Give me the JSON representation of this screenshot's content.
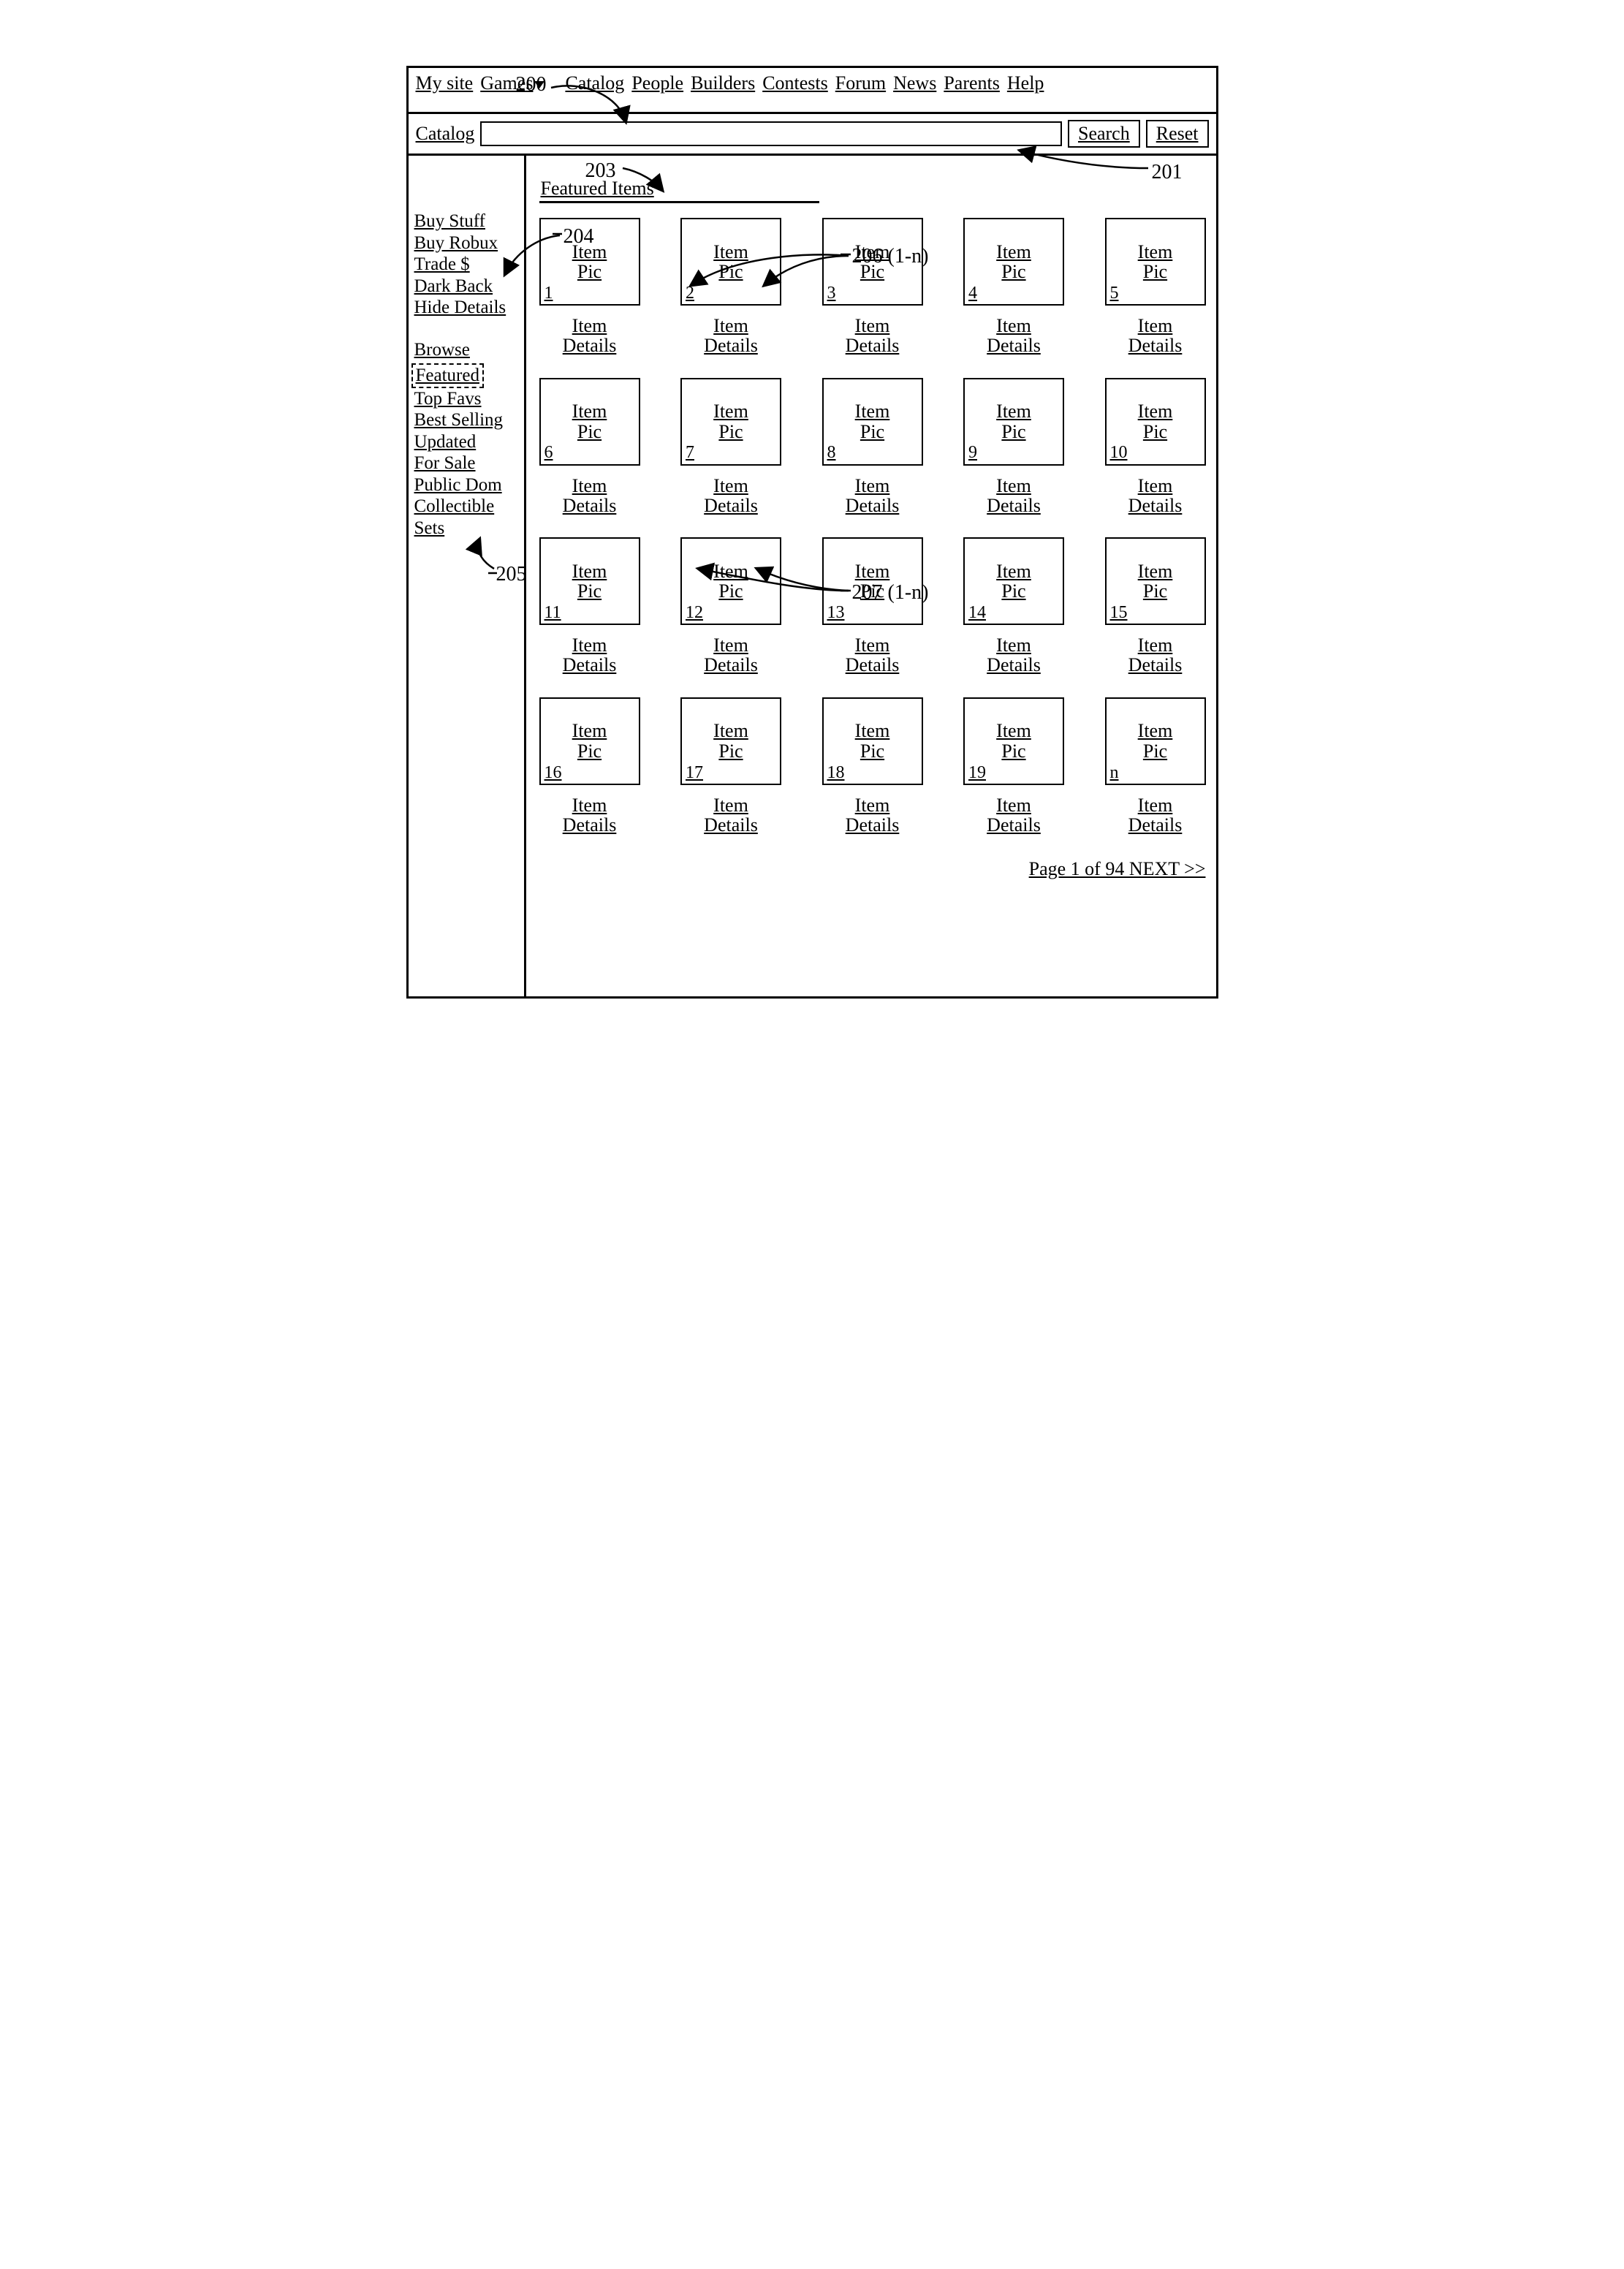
{
  "refs": {
    "r200": "200",
    "r201": "201",
    "r203": "203",
    "r204": "204",
    "r205": "205",
    "r206": "206 (1-n)",
    "r207": "207 (1-n)"
  },
  "nav": {
    "mysite": "My site",
    "games": "Games",
    "catalog": "Catalog",
    "people": "People",
    "builders": "Builders",
    "contests": "Contests",
    "forum": "Forum",
    "news": "News",
    "parents": "Parents",
    "help": "Help"
  },
  "search": {
    "label": "Catalog",
    "search_btn": "Search",
    "reset_btn": "Reset"
  },
  "sidebar": {
    "buy": {
      "buystuff": "Buy Stuff",
      "buyrobux": "Buy Robux",
      "trade": "Trade $",
      "darkback": "Dark Back",
      "hidedetails": "Hide Details"
    },
    "browse_hdr": "Browse",
    "browse": {
      "featured": "Featured",
      "topfavs": "Top Favs",
      "bestselling": "Best Selling",
      "updated": "Updated",
      "forsale": "For Sale",
      "publicdom": "Public Dom",
      "collectible": "Collectible",
      "sets": "Sets"
    }
  },
  "main": {
    "heading": "Featured Items",
    "pic_l1": "Item",
    "pic_l2": "Pic",
    "det_l1": "Item",
    "det_l2": "Details",
    "nums": [
      "1",
      "2",
      "3",
      "4",
      "5",
      "6",
      "7",
      "8",
      "9",
      "10",
      "11",
      "12",
      "13",
      "14",
      "15",
      "16",
      "17",
      "18",
      "19",
      "n"
    ],
    "pager": "Page 1 of 94 NEXT >>"
  }
}
